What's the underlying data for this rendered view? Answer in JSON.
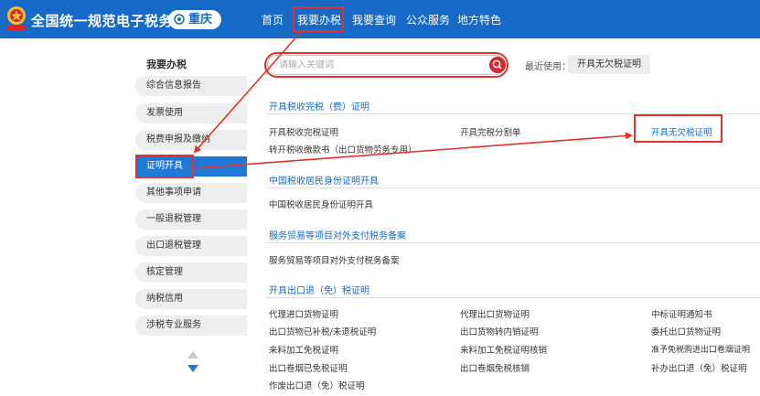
{
  "header": {
    "site_title": "全国统一规范电子税务局",
    "region": "重庆",
    "emblem_text": "中国税务",
    "nav": [
      "首页",
      "我要办税",
      "我要查询",
      "公众服务",
      "地方特色"
    ]
  },
  "sidebar": {
    "heading": "我要办税",
    "items": [
      "综合信息报告",
      "发票使用",
      "税费申报及缴纳",
      "证明开具",
      "其他事项申请",
      "一般退税管理",
      "出口退税管理",
      "核定管理",
      "纳税信用",
      "涉税专业服务"
    ],
    "active_index": 3
  },
  "search": {
    "placeholder": "请输入关键词",
    "recent_label": "最近使用：",
    "recent_item": "开具无欠税证明"
  },
  "sections": [
    {
      "title": "开具税收完税（费）证明",
      "links": [
        "开具税收完税证明",
        "开具完税分割单",
        "开具无欠税证明",
        "转开税收缴款书（出口货物劳务专用）"
      ]
    },
    {
      "title": "中国税收居民身份证明开具",
      "links": [
        "中国税收居民身份证明开具"
      ]
    },
    {
      "title": "服务贸易等项目对外支付税务备案",
      "links": [
        "服务贸易等项目对外支付税务备案"
      ]
    },
    {
      "title": "开具出口退（免）税证明",
      "links": [
        "代理进口货物证明",
        "代理出口货物证明",
        "中标证明通知书",
        "出口货物已补税/未退税证明",
        "出口货物转内销证明",
        "委托出口货物证明",
        "来料加工免税证明",
        "来料加工免税证明核销",
        "准予免税购进出口卷烟证明",
        "出口卷烟已免税证明",
        "出口卷烟免税核销",
        "补办出口退（免）税证明",
        "作废出口退（免）税证明"
      ]
    }
  ],
  "colors": {
    "header_bg": "#1769c6",
    "active_bg": "#1e78d6",
    "highlight": "#e4322b",
    "link_blue": "#1769c6"
  }
}
